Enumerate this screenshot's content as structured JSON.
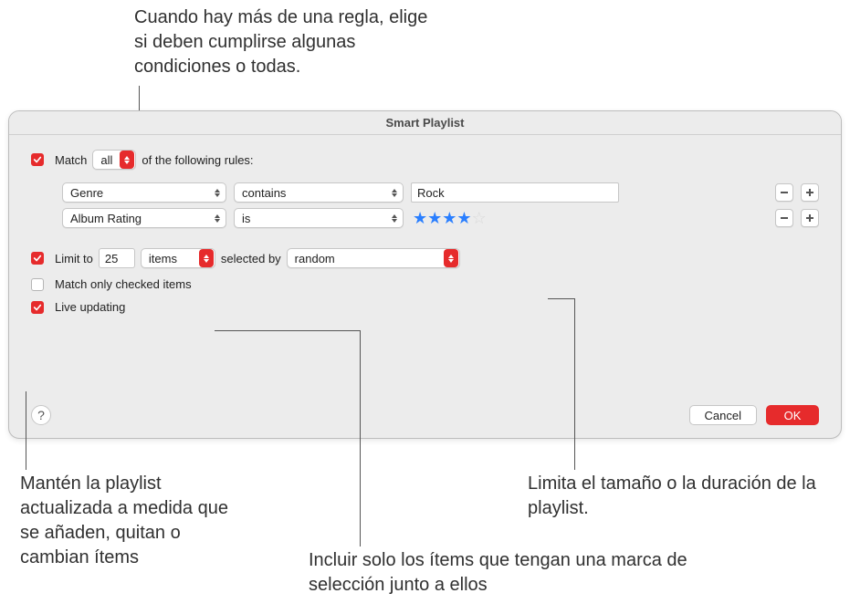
{
  "dialog": {
    "title": "Smart Playlist",
    "match": {
      "checked": true,
      "prefix": "Match",
      "mode": "all",
      "suffix": "of the following rules:"
    },
    "rules": [
      {
        "attribute": "Genre",
        "condition": "contains",
        "value_text": "Rock",
        "value_stars": null
      },
      {
        "attribute": "Album Rating",
        "condition": "is",
        "value_text": null,
        "value_stars": 4
      }
    ],
    "limit": {
      "checked": true,
      "prefix": "Limit to",
      "amount": "25",
      "unit": "items",
      "selected_by_label": "selected by",
      "selection": "random"
    },
    "match_only_checked": {
      "checked": false,
      "label": "Match only checked items"
    },
    "live_updating": {
      "checked": true,
      "label": "Live updating"
    },
    "buttons": {
      "help": "?",
      "cancel": "Cancel",
      "ok": "OK"
    }
  },
  "callouts": {
    "top": "Cuando hay más de una regla, elige si deben cumplirse algunas condiciones o todas.",
    "bottom_left": "Mantén la playlist actualizada a medida que se añaden, quitan o cambian ítems",
    "bottom_mid": "Incluir solo los ítems que tengan una marca de selección junto a ellos",
    "bottom_right": "Limita el tamaño o la duración de la playlist."
  }
}
